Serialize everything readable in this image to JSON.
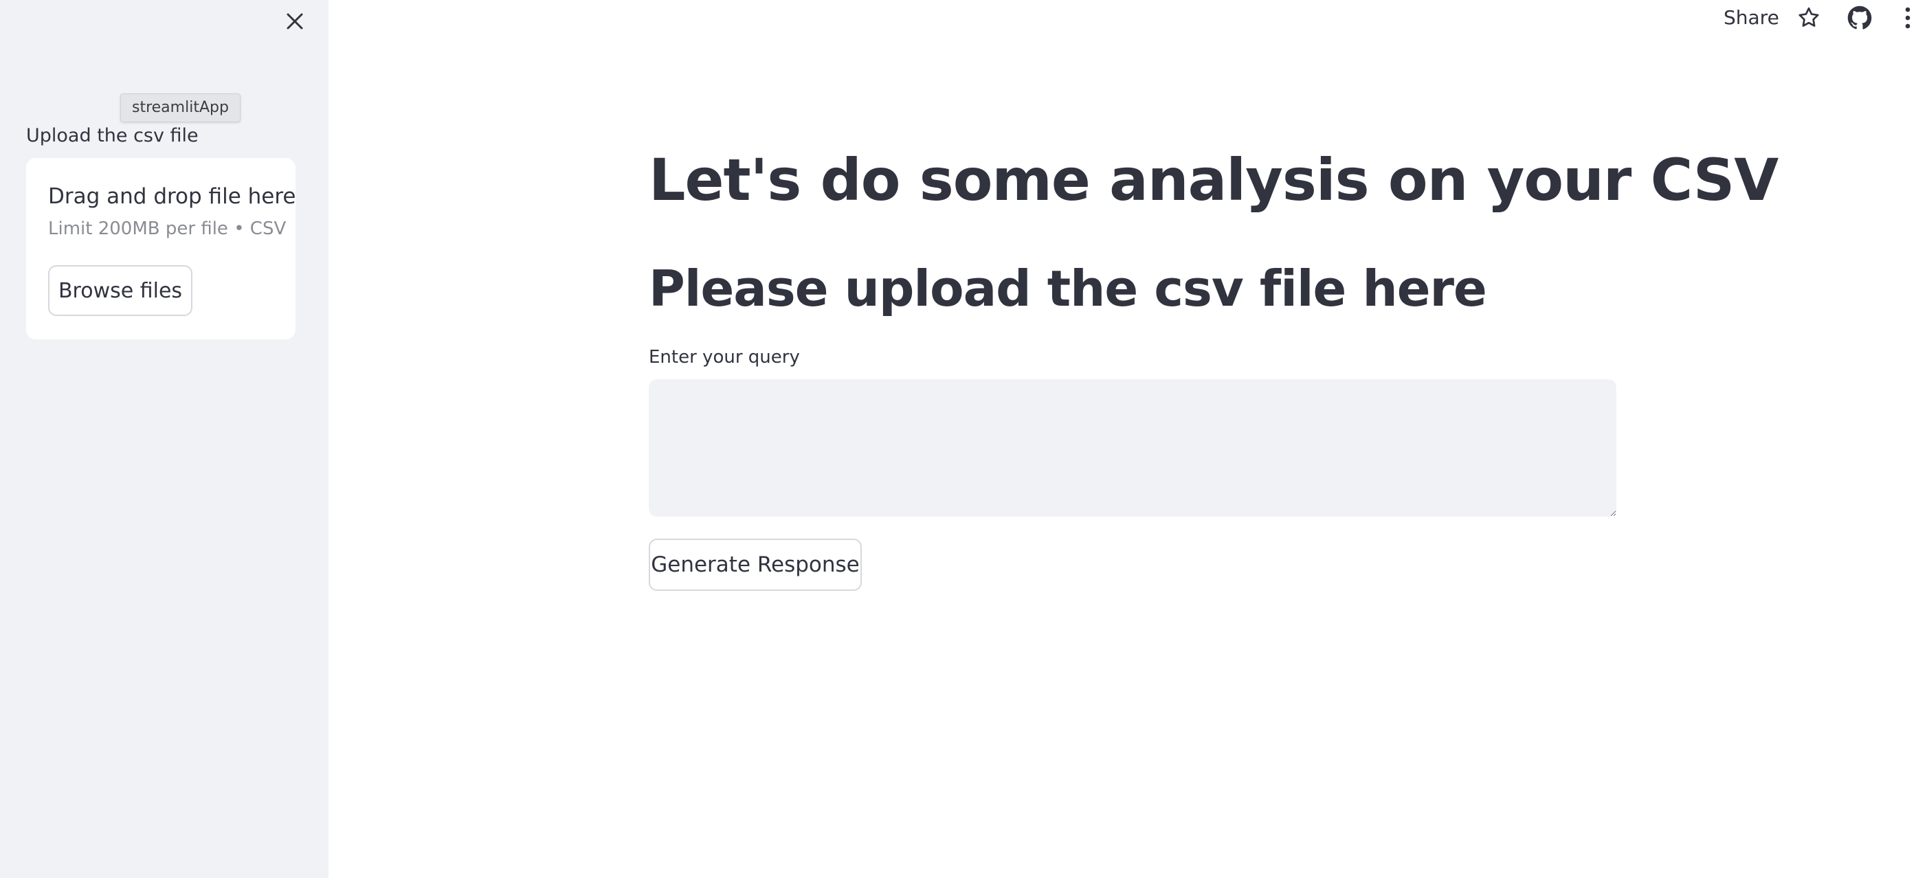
{
  "sidebar": {
    "close_icon": "close-icon",
    "tooltip": "streamlitApp",
    "upload_label": "Upload the csv file",
    "dropzone": {
      "title": "Drag and drop file here",
      "limit": "Limit 200MB per file • CSV",
      "browse_label": "Browse files"
    }
  },
  "header": {
    "share_label": "Share",
    "icons": [
      "star-icon",
      "github-icon",
      "kebab-menu-icon"
    ]
  },
  "main": {
    "title": "Let's do some analysis on your CSV",
    "subtitle": "Please upload the csv file here",
    "query_label": "Enter your query",
    "query_value": "",
    "generate_label": "Generate Response"
  },
  "colors": {
    "sidebar_bg": "#f0f2f6",
    "text": "#31333f",
    "muted_text": "#8a8c93",
    "input_bg": "#f0f2f6",
    "button_border": "#d6d8dd"
  }
}
